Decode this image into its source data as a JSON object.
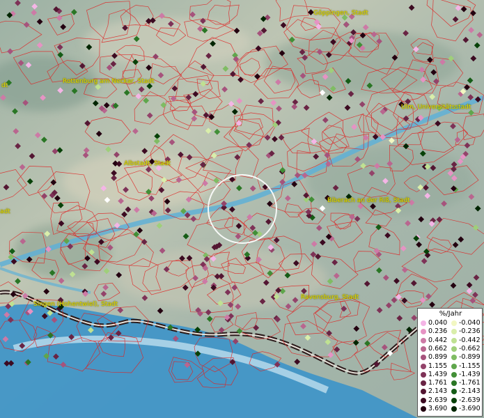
{
  "map": {
    "places": [
      {
        "name": "Göppingen, Stadt"
      },
      {
        "name": "Rottenburg am Neckar, Stadt"
      },
      {
        "name": "Ulm, Universitätsstadt"
      },
      {
        "name": "Albstadt, Stadt"
      },
      {
        "name": "Biberach an der Riß, Stadt"
      },
      {
        "name": "Singen (Hohentwiel), Stadt"
      },
      {
        "name": "Ravensburg, Stadt"
      },
      {
        "name": "dt"
      },
      {
        "name": "adt"
      }
    ],
    "colors": {
      "boundary": "#e02020",
      "terrain_base": "#a7b8ad",
      "water": "#5fb0d6",
      "lake": "#3c93c9",
      "highlight_circle": "#ffffff"
    }
  },
  "legend": {
    "title": "%/Jahr",
    "positive": [
      {
        "value": "0.040",
        "color": "#f4b5e6"
      },
      {
        "value": "0.236",
        "color": "#e693c4"
      },
      {
        "value": "0.442",
        "color": "#cd7aa6"
      },
      {
        "value": "0.662",
        "color": "#b9668f"
      },
      {
        "value": "0.899",
        "color": "#a6537c"
      },
      {
        "value": "1.155",
        "color": "#93436a"
      },
      {
        "value": "1.439",
        "color": "#7e3257"
      },
      {
        "value": "1.761",
        "color": "#692444"
      },
      {
        "value": "2.143",
        "color": "#531632"
      },
      {
        "value": "2.639",
        "color": "#3c0a21"
      },
      {
        "value": "3.690",
        "color": "#230010"
      }
    ],
    "negative": [
      {
        "value": "-0.040",
        "color": "#f2f7c2"
      },
      {
        "value": "-0.236",
        "color": "#d9eeaa"
      },
      {
        "value": "-0.442",
        "color": "#bfe192"
      },
      {
        "value": "-0.662",
        "color": "#9fcf7a"
      },
      {
        "value": "-0.899",
        "color": "#7fbc63"
      },
      {
        "value": "-1.155",
        "color": "#5fa64c"
      },
      {
        "value": "-1.439",
        "color": "#428f37"
      },
      {
        "value": "-1.761",
        "color": "#2a7625"
      },
      {
        "value": "-2.143",
        "color": "#155c16"
      },
      {
        "value": "-2.639",
        "color": "#074108"
      },
      {
        "value": "-3.690",
        "color": "#002500"
      }
    ]
  }
}
